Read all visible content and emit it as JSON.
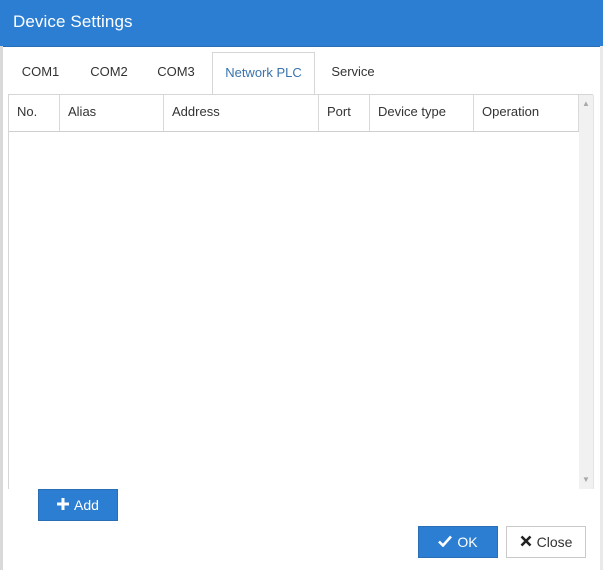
{
  "dialog": {
    "title": "Device Settings"
  },
  "tabs": [
    {
      "label": "COM1",
      "active": false
    },
    {
      "label": "COM2",
      "active": false
    },
    {
      "label": "COM3",
      "active": false
    },
    {
      "label": "Network PLC",
      "active": true
    },
    {
      "label": "Service",
      "active": false
    }
  ],
  "table": {
    "columns": [
      "No.",
      "Alias",
      "Address",
      "Port",
      "Device type",
      "Operation"
    ],
    "rows": []
  },
  "buttons": {
    "add_label": "Add",
    "ok_label": "OK",
    "close_label": "Close"
  },
  "colors": {
    "accent": "#2b7ed1",
    "active_tab_text": "#3a73ad"
  },
  "icons": {
    "add": "plus-icon",
    "ok": "check-icon",
    "close": "x-icon",
    "scroll_up": "scroll-up-arrow-icon",
    "scroll_down": "scroll-down-arrow-icon"
  }
}
